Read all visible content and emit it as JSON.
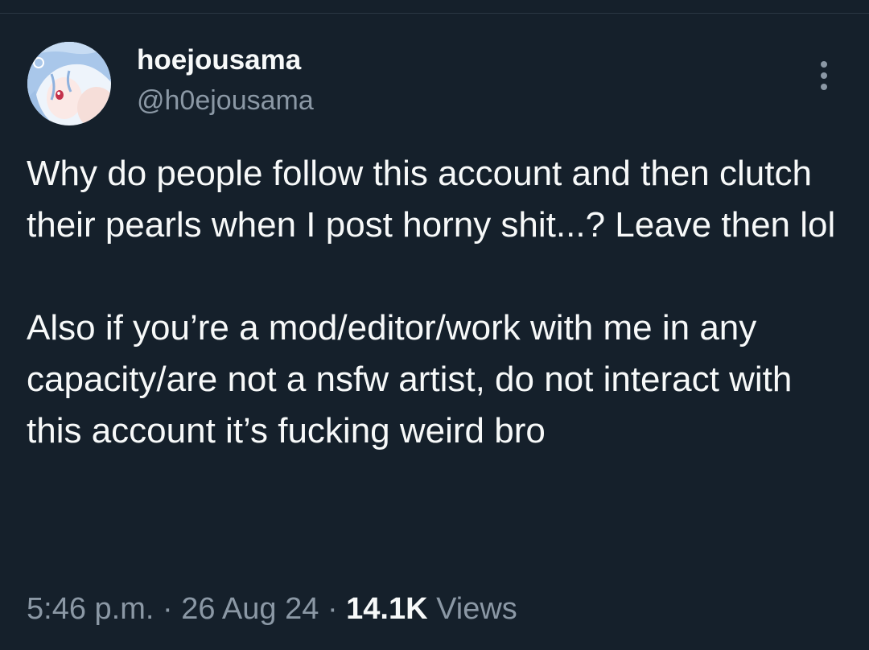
{
  "author": {
    "display_name": "hoejousama",
    "handle": "@h0ejousama",
    "avatar_icon": "anime-avatar-image"
  },
  "more_icon": "more-vertical-icon",
  "tweet": {
    "paragraph_1": "Why do people follow this account and then clutch their pearls when I post horny shit...? Leave then lol",
    "paragraph_2": "Also if you’re a mod/editor/work with me in any capacity/are not a nsfw artist, do not interact with this account it’s fucking weird bro"
  },
  "meta": {
    "time": "5:46 p.m.",
    "separator": "·",
    "date": "26 Aug 24",
    "views_count": "14.1K",
    "views_label": "Views"
  },
  "colors": {
    "background": "#15202b",
    "primary_text": "#f7f9f9",
    "secondary_text": "#8b98a5"
  }
}
